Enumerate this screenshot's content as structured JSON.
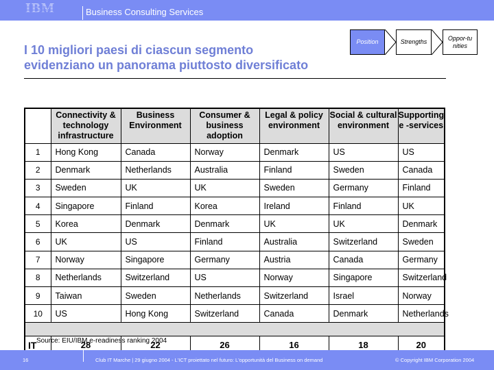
{
  "header": {
    "logo": "IBM",
    "division": "Business Consulting Services",
    "brand_color": "#7a8cf4"
  },
  "title": {
    "line1": "I 10 migliori paesi di ciascun segmento",
    "line2": "evidenziano un panorama piuttosto diversificato",
    "color": "#6f7fd6"
  },
  "steps": [
    {
      "label": "Position",
      "active": true
    },
    {
      "label": "Strengths",
      "active": false
    },
    {
      "label": "Oppor-tunities",
      "active": false
    }
  ],
  "table": {
    "columns": [
      "",
      "Connectivity & technology infrastructure",
      "Business Environment",
      "Consumer & business adoption",
      "Legal & policy environment",
      "Social & cultural environment",
      "Supporting e -services"
    ],
    "rows": [
      {
        "rank": "1",
        "cells": [
          "Hong Kong",
          "Canada",
          "Norway",
          "Denmark",
          "US",
          "US"
        ]
      },
      {
        "rank": "2",
        "cells": [
          "Denmark",
          "Netherlands",
          "Australia",
          "Finland",
          "Sweden",
          "Canada"
        ]
      },
      {
        "rank": "3",
        "cells": [
          "Sweden",
          "UK",
          "UK",
          "Sweden",
          "Germany",
          "Finland"
        ]
      },
      {
        "rank": "4",
        "cells": [
          "Singapore",
          "Finland",
          "Korea",
          "Ireland",
          "Finland",
          "UK"
        ]
      },
      {
        "rank": "5",
        "cells": [
          "Korea",
          "Denmark",
          "Denmark",
          "UK",
          "UK",
          "Denmark"
        ]
      },
      {
        "rank": "6",
        "cells": [
          "UK",
          "US",
          "Finland",
          "Australia",
          "Switzerland",
          "Sweden"
        ]
      },
      {
        "rank": "7",
        "cells": [
          "Norway",
          "Singapore",
          "Germany",
          "Austria",
          "Canada",
          "Germany"
        ]
      },
      {
        "rank": "8",
        "cells": [
          "Netherlands",
          "Switzerland",
          "US",
          "Norway",
          "Singapore",
          "Switzerland"
        ]
      },
      {
        "rank": "9",
        "cells": [
          "Taiwan",
          "Sweden",
          "Netherlands",
          "Switzerland",
          "Israel",
          "Norway"
        ]
      },
      {
        "rank": "10",
        "cells": [
          "US",
          "Hong Kong",
          "Switzerland",
          "Canada",
          "Denmark",
          "Netherlands"
        ]
      }
    ],
    "italy_row": {
      "label": "IT",
      "values": [
        "28",
        "22",
        "26",
        "16",
        "18",
        "20"
      ]
    }
  },
  "source": "Source: EIU/IBM e-readiness ranking 2004",
  "footer": {
    "page": "16",
    "event": "Club IT Marche | 29 giugno 2004 - L'ICT proiettato nel futuro: L'opportunità del Business on demand",
    "copyright": "© Copyright IBM Corporation 2004"
  }
}
